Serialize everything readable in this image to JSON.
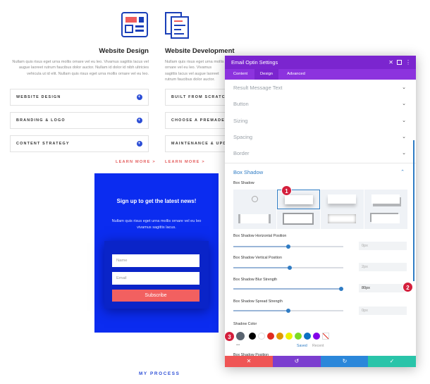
{
  "services": [
    {
      "title": "Website Design",
      "desc": "Nullam quis risus eget urna mollis ornare vel eu leo. Vivamus sagittis lacus vel augue laoreet rutrum faucibus dolor auctor. Nullam id dolor id nibh ultricies vehicula ut id elit. Nullam quis risus eget urna mollis ornare vel eu leo."
    },
    {
      "title": "Website Development",
      "desc": "Nullam quis risus eget urna mollis ornare vel eu leo. Vivamus sagittis lacus vel augue laoreet rutrum faucibus dolor auctor. Nullam id dolor id nibh ultricies vehicula ut id elit. Nullam quis risus eget urna mollis ornare vel eu leo."
    }
  ],
  "accordions_left": [
    "WEBSITE DESIGN",
    "BRANDING & LOGO",
    "CONTENT STRATEGY"
  ],
  "accordions_right": [
    "BUILT FROM SCRATCH",
    "CHOOSE A PREMADE TEM",
    "MAINTENANCE & UPDATE"
  ],
  "learn_more": "LEARN MORE >",
  "optin": {
    "title": "Sign up to get the latest news!",
    "body": "Nullam quis risus eget urna mollis ornare vel eu leo vivamus sagittis lacus.",
    "name_placeholder": "Name",
    "email_placeholder": "Email",
    "subscribe_label": "Subscribe"
  },
  "my_process": "MY PROCESS",
  "panel": {
    "title": "Email Optin Settings",
    "tabs": [
      "Content",
      "Design",
      "Advanced"
    ],
    "active_tab": "Design",
    "sections": [
      "Result Message Text",
      "Button",
      "Sizing",
      "Spacing",
      "Border"
    ],
    "open_section": "Box Shadow",
    "box_shadow_label": "Box Shadow",
    "fields": [
      {
        "label": "Box Shadow Horizontal Position",
        "value": "0px",
        "level": 0.5
      },
      {
        "label": "Box Shadow Vertical Position",
        "value": "2px",
        "level": 0.51
      },
      {
        "label": "Box Shadow Blur Strength",
        "value": "80px",
        "level": 0.98
      },
      {
        "label": "Box Shadow Spread Strength",
        "value": "0px",
        "level": 0.5
      }
    ],
    "shadow_color_label": "Shadow Color",
    "swatches": [
      "#000000",
      "#ffffff",
      "#e02b20",
      "#e09900",
      "#edf000",
      "#7cda24",
      "#0c71c3",
      "#8300e9"
    ],
    "saved_label": "Saved",
    "recent_label": "Recent",
    "more_dots": "•••",
    "truncated_next": "Box Shadow Position",
    "footer_colors": [
      "#ef5555",
      "#7b3ecf",
      "#2b87da",
      "#29c4a9"
    ]
  },
  "badges": [
    "1",
    "2",
    "3"
  ],
  "colors": {
    "accent_purple": "#7b25cf",
    "optin_blue": "#0b2cf0",
    "badge_red": "#d41f3c"
  }
}
